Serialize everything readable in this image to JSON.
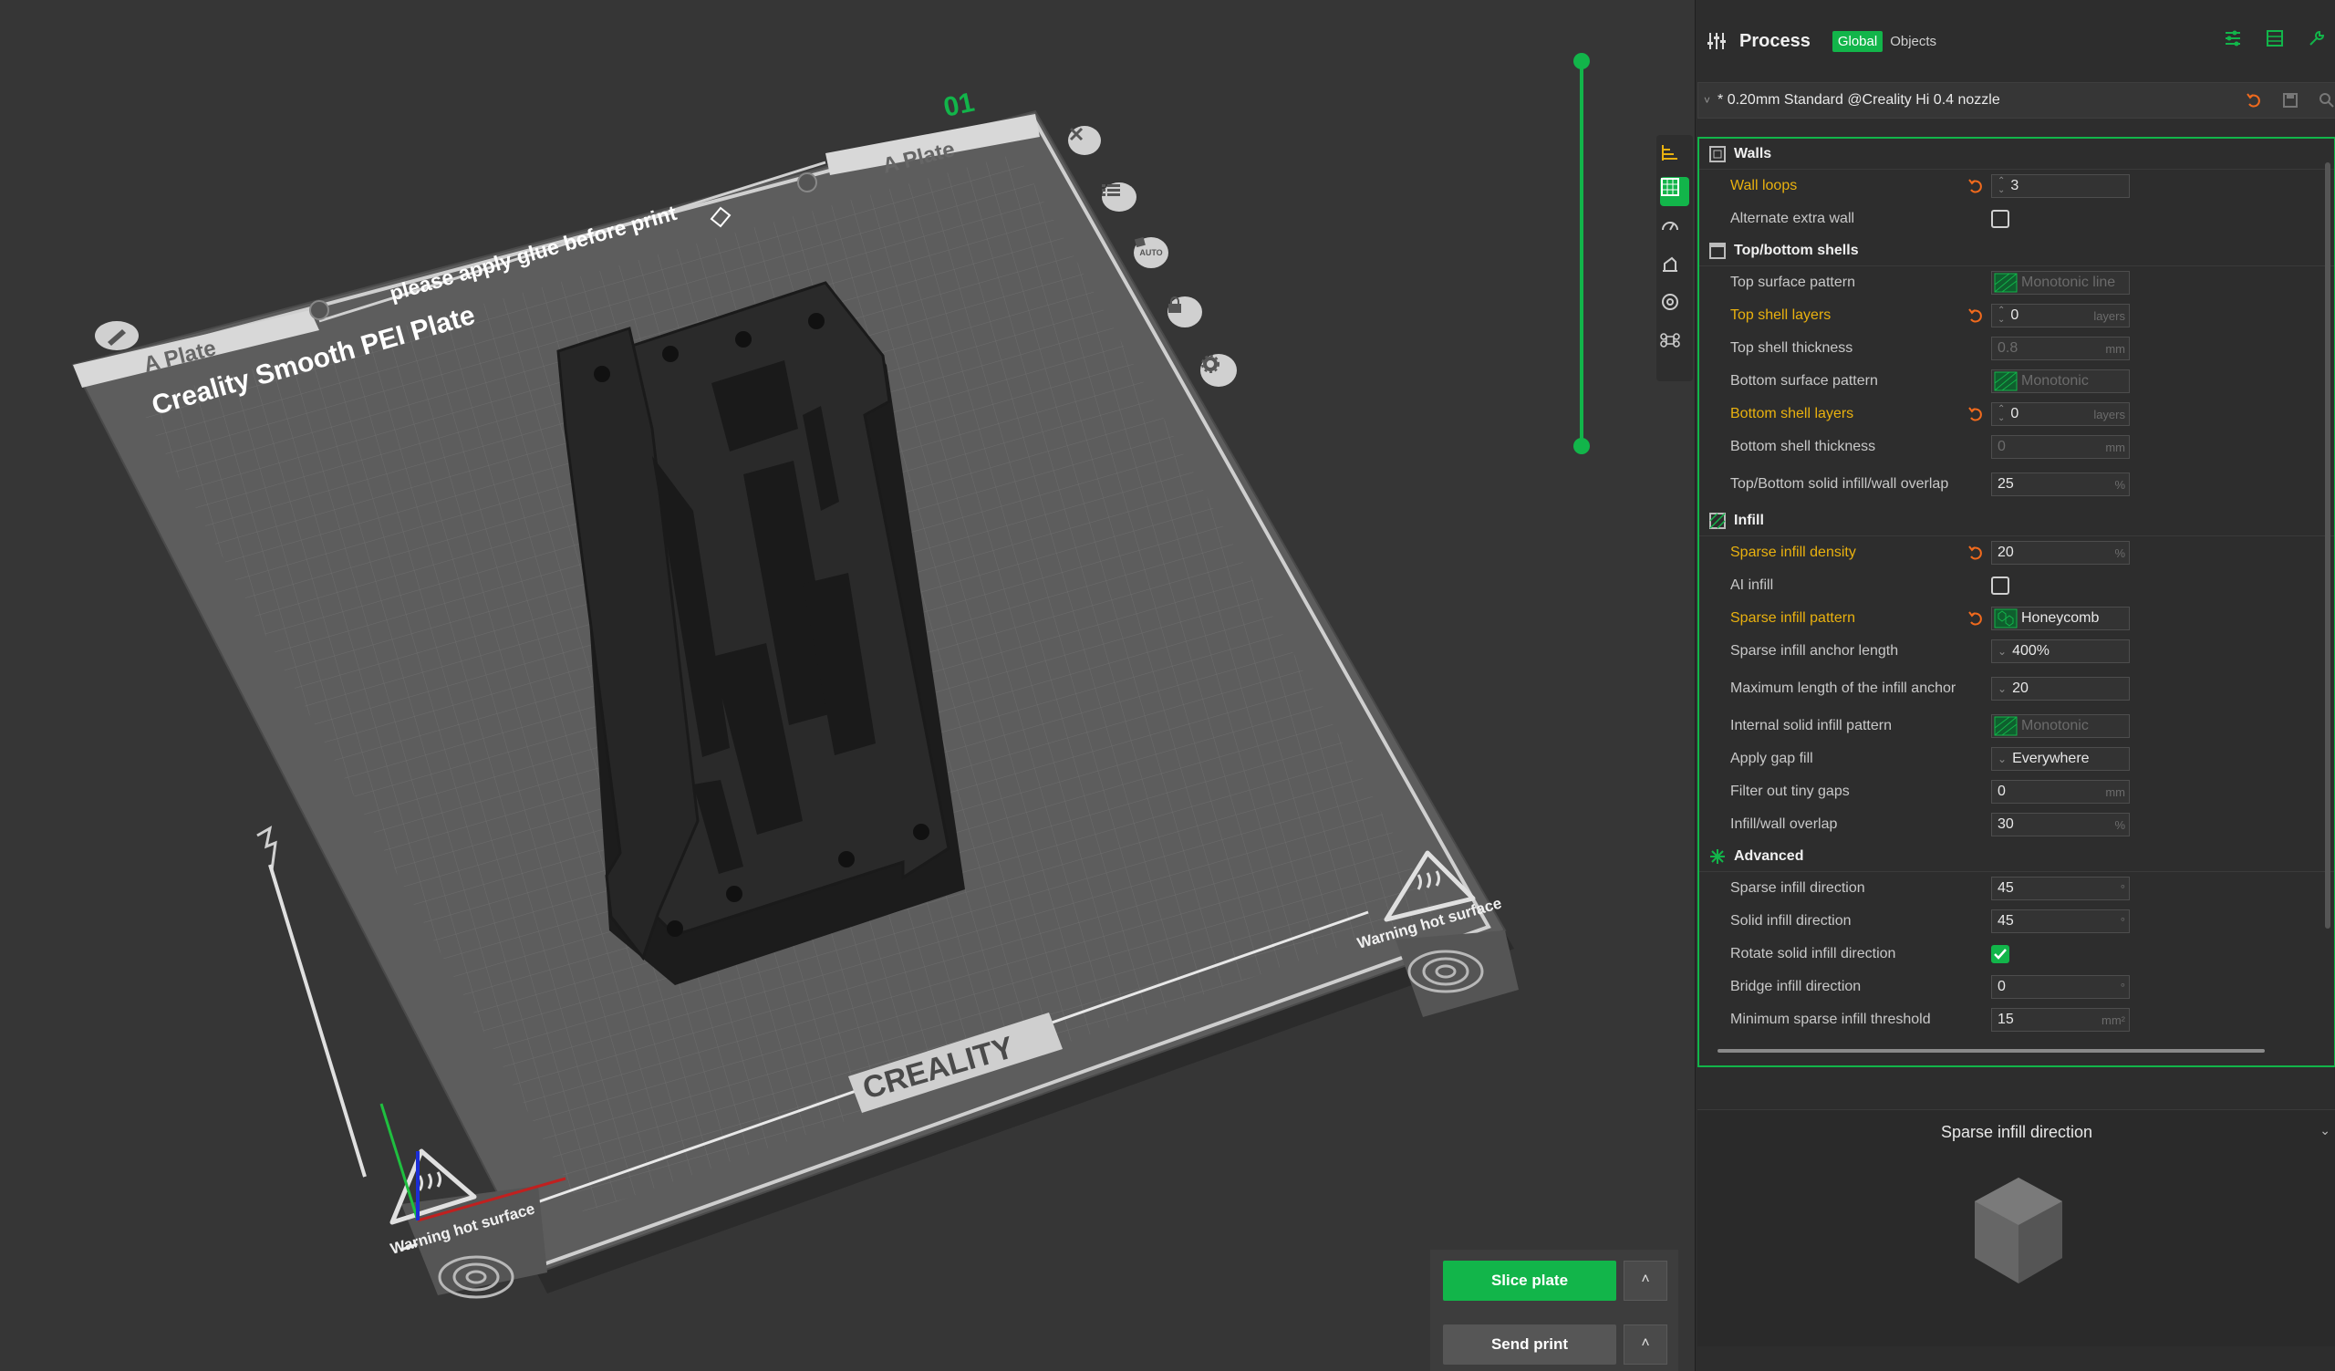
{
  "plate": {
    "number": "01",
    "name_tab": "A Plate",
    "name_tab_left": "A Plate",
    "title": "Creality Smooth PEI Plate",
    "glue_note": "please apply glue before print",
    "brand": "CREALITY",
    "warning_left": "Warning hot surface",
    "warning_right": "Warning hot surface",
    "auto_label": "AUTO"
  },
  "actions": {
    "slice_label": "Slice plate",
    "send_label": "Send print",
    "caret": "˄"
  },
  "panel": {
    "title": "Process",
    "seg_global": "Global",
    "seg_objects": "Objects",
    "preset": "* 0.20mm Standard @Creality Hi 0.4 nozzle",
    "preset_caret": "˅"
  },
  "sections": {
    "walls": "Walls",
    "shells": "Top/bottom shells",
    "infill": "Infill",
    "advanced": "Advanced"
  },
  "settings": {
    "wall_loops": {
      "label": "Wall loops",
      "value": "3"
    },
    "alt_extra_wall": {
      "label": "Alternate extra wall",
      "checked": false
    },
    "top_surface_pattern": {
      "label": "Top surface pattern",
      "value": "Monotonic line"
    },
    "top_shell_layers": {
      "label": "Top shell layers",
      "value": "0",
      "unit": "layers"
    },
    "top_shell_thickness": {
      "label": "Top shell thickness",
      "value": "0.8",
      "unit": "mm"
    },
    "bottom_surface_pattern": {
      "label": "Bottom surface pattern",
      "value": "Monotonic"
    },
    "bottom_shell_layers": {
      "label": "Bottom shell layers",
      "value": "0",
      "unit": "layers"
    },
    "bottom_shell_thickness": {
      "label": "Bottom shell thickness",
      "value": "0",
      "unit": "mm"
    },
    "solid_overlap": {
      "label": "Top/Bottom solid infill/wall overlap",
      "value": "25",
      "unit": "%"
    },
    "sparse_density": {
      "label": "Sparse infill density",
      "value": "20",
      "unit": "%"
    },
    "ai_infill": {
      "label": "AI infill",
      "checked": false
    },
    "sparse_pattern": {
      "label": "Sparse infill pattern",
      "value": "Honeycomb"
    },
    "anchor_length": {
      "label": "Sparse infill anchor length",
      "value": "400%"
    },
    "max_anchor": {
      "label": "Maximum length of the infill anchor",
      "value": "20"
    },
    "internal_solid_pattern": {
      "label": "Internal solid infill pattern",
      "value": "Monotonic"
    },
    "gap_fill": {
      "label": "Apply gap fill",
      "value": "Everywhere"
    },
    "filter_gaps": {
      "label": "Filter out tiny gaps",
      "value": "0",
      "unit": "mm"
    },
    "infill_wall_overlap": {
      "label": "Infill/wall overlap",
      "value": "30",
      "unit": "%"
    },
    "sparse_direction": {
      "label": "Sparse infill direction",
      "value": "45",
      "unit": "°"
    },
    "solid_direction": {
      "label": "Solid infill direction",
      "value": "45",
      "unit": "°"
    },
    "rotate_solid": {
      "label": "Rotate solid infill direction",
      "checked": true
    },
    "bridge_direction": {
      "label": "Bridge infill direction",
      "value": "0",
      "unit": "°"
    },
    "min_sparse_threshold": {
      "label": "Minimum sparse infill threshold",
      "value": "15",
      "unit": "mm²"
    }
  },
  "help": {
    "title": "Sparse infill direction",
    "collapse": "⌄"
  },
  "colors": {
    "accent": "#12b54a",
    "modified": "#e9b10f",
    "reset": "#f06a1d"
  }
}
